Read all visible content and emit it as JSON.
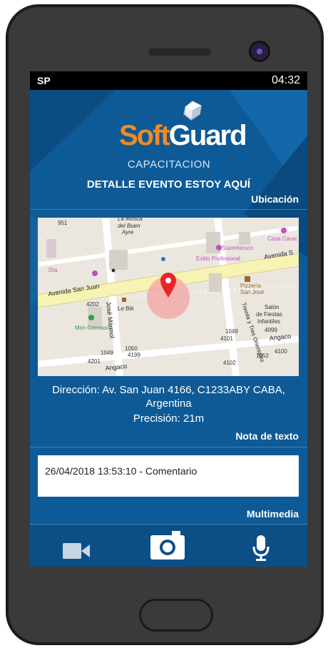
{
  "status_bar": {
    "carrier": "SP",
    "time": "04:32"
  },
  "logo": {
    "brand_soft": "Soft",
    "brand_guard": "Guard",
    "subtitle": "CAPACITACION"
  },
  "page_title": "DETALLE EVENTO ESTOY AQUÍ",
  "sections": {
    "location_label": "Ubicación",
    "text_note_label": "Nota de texto",
    "multimedia_label": "Multimedia"
  },
  "map": {
    "streets": [
      "Avenida San Juan",
      "Avenida S",
      "José Mármol",
      "Treinta y Tres Orientales",
      "Angaco",
      "Angaco"
    ],
    "places": [
      "Día",
      "Le Blé",
      "Mim Gimnasio",
      "Superkiosco",
      "Estilo Profesional",
      "Pizzería San José",
      "Salón de Fiestas Infantiles",
      "Casa Carac",
      "La Mosca del Buen Ayre"
    ],
    "numbers": [
      "951",
      "4202",
      "4201",
      "1049",
      "1050",
      "4199",
      "1049",
      "4101",
      "4102",
      "1052",
      "4100",
      "4099"
    ],
    "accuracy_meters": 21
  },
  "address": {
    "line1": "Dirección: Av. San Juan 4166, C1233ABY CABA,",
    "line2": "Argentina",
    "precision": "Precisión: 21m"
  },
  "note": {
    "text": "26/04/2018 13:53:10 - Comentario"
  },
  "toolbar": {
    "icons": [
      "video-camera-icon",
      "camera-icon",
      "microphone-icon"
    ]
  },
  "colors": {
    "background": "#0e5a96",
    "accent": "#f08a24",
    "pin": "#e8232a"
  }
}
